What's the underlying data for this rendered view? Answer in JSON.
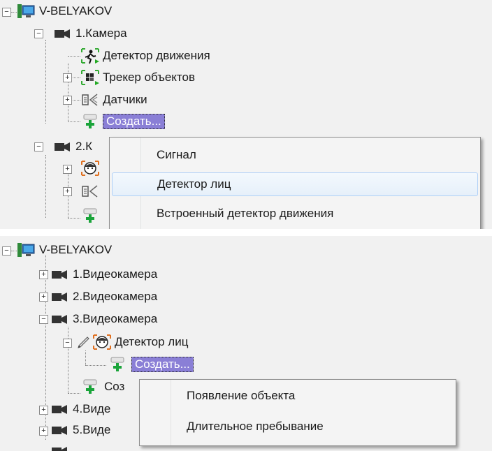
{
  "top": {
    "root": "V-BELYAKOV",
    "camera1": "1.Камера",
    "motion": "Детектор движения",
    "tracker": "Трекер объектов",
    "sensors": "Датчики",
    "create": "Создать...",
    "camera2_partial": "2.К",
    "menu": [
      "Сигнал",
      "Детектор лиц",
      "Встроенный детектор движения"
    ]
  },
  "bottom": {
    "root": "V-BELYAKOV",
    "cam1": "1.Видеокамера",
    "cam2": "2.Видеокамера",
    "cam3": "3.Видеокамера",
    "face": "Детектор лиц",
    "create_sel": "Создать...",
    "create_partial": "Соз",
    "cam4_partial": "4.Виде",
    "cam5_partial": "5.Виде",
    "menu": [
      "Появление объекта",
      "Длительное пребывание"
    ]
  },
  "icons": {
    "server": "server-icon",
    "camera": "camera-icon",
    "motion": "motion-detector-icon",
    "tracker": "object-tracker-icon",
    "sensor": "sensor-icon",
    "create": "create-plus-icon",
    "face": "face-detector-icon",
    "pencil": "pencil-icon"
  },
  "colors": {
    "selection": "#8a7fd6",
    "plus": "#1aa43a",
    "menu_hover_border": "#aecff7"
  }
}
